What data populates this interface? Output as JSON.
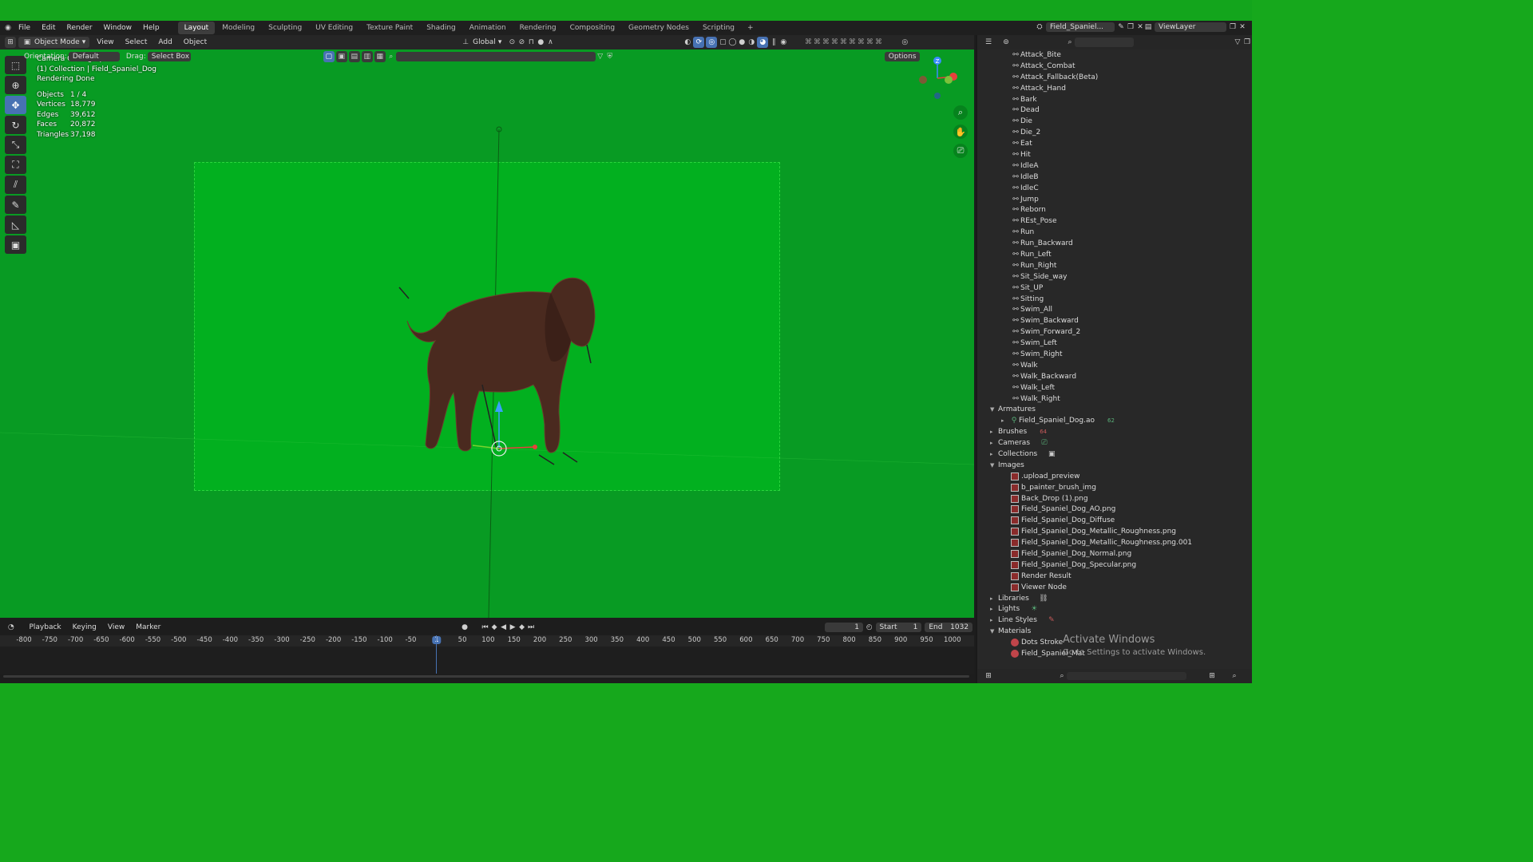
{
  "menu": [
    "File",
    "Edit",
    "Render",
    "Window",
    "Help"
  ],
  "workspaces": [
    "Layout",
    "Modeling",
    "Sculpting",
    "UV Editing",
    "Texture Paint",
    "Shading",
    "Animation",
    "Rendering",
    "Compositing",
    "Geometry Nodes",
    "Scripting"
  ],
  "workspace_add": "+",
  "scene_name": "Field_Spaniel...",
  "view_layer": "ViewLayer",
  "header": {
    "mode": "Object Mode",
    "items": [
      "View",
      "Select",
      "Add",
      "Object"
    ],
    "transform": "Global",
    "options": "Options"
  },
  "tool_settings": {
    "orientation_label": "Orientation:",
    "orientation_value": "Default",
    "drag_label": "Drag:",
    "drag_value": "Select Box"
  },
  "viewport_info": {
    "line1": "Camera Orthographic",
    "line2": "(1) Collection | Field_Spaniel_Dog",
    "line3": "Rendering Done",
    "stats": [
      {
        "k": "Objects",
        "v": "1 / 4"
      },
      {
        "k": "Vertices",
        "v": "18,779"
      },
      {
        "k": "Edges",
        "v": "39,612"
      },
      {
        "k": "Faces",
        "v": "20,872"
      },
      {
        "k": "Triangles",
        "v": "37,198"
      }
    ]
  },
  "outliner": {
    "actions": [
      "Attack_Bite",
      "Attack_Combat",
      "Attack_Fallback(Beta)",
      "Attack_Hand",
      "Bark",
      "Dead",
      "Die",
      "Die_2",
      "Eat",
      "Hit",
      "IdleA",
      "IdleB",
      "IdleC",
      "Jump",
      "Reborn",
      "REst_Pose",
      "Run",
      "Run_Backward",
      "Run_Left",
      "Run_Right",
      "Sit_Side_way",
      "Sit_UP",
      "Sitting",
      "Swim_All",
      "Swim_Backward",
      "Swim_Forward_2",
      "Swim_Left",
      "Swim_Right",
      "Walk",
      "Walk_Backward",
      "Walk_Left",
      "Walk_Right"
    ],
    "armatures_label": "Armatures",
    "armature_item": "Field_Spaniel_Dog.ao",
    "armature_count": "62",
    "brushes_label": "Brushes",
    "brushes_count": "64",
    "cameras_label": "Cameras",
    "collections_label": "Collections",
    "images_label": "Images",
    "images": [
      ".upload_preview",
      "b_painter_brush_img",
      "Back_Drop (1).png",
      "Field_Spaniel_Dog_AO.png",
      "Field_Spaniel_Dog_Diffuse",
      "Field_Spaniel_Dog_Metallic_Roughness.png",
      "Field_Spaniel_Dog_Metallic_Roughness.png.001",
      "Field_Spaniel_Dog_Normal.png",
      "Field_Spaniel_Dog_Specular.png",
      "Render Result",
      "Viewer Node"
    ],
    "libraries_label": "Libraries",
    "lights_label": "Lights",
    "linestyles_label": "Line Styles",
    "materials_label": "Materials",
    "materials": [
      "Dots Stroke",
      "Field_Spaniel_Mat"
    ]
  },
  "timeline": {
    "menus": [
      "Playback",
      "Keying",
      "View",
      "Marker"
    ],
    "current_frame": "1",
    "start_label": "Start",
    "start": "1",
    "end_label": "End",
    "end": "1032",
    "ruler": [
      "-800",
      "-750",
      "-700",
      "-650",
      "-600",
      "-550",
      "-500",
      "-450",
      "-400",
      "-350",
      "-300",
      "-250",
      "-200",
      "-150",
      "-100",
      "-50",
      "1",
      "50",
      "100",
      "150",
      "200",
      "250",
      "300",
      "350",
      "400",
      "450",
      "500",
      "550",
      "600",
      "650",
      "700",
      "750",
      "800",
      "850",
      "900",
      "950",
      "1000"
    ]
  },
  "watermark": {
    "title": "Activate Windows",
    "subtitle": "Go to Settings to activate Windows."
  },
  "colors": {
    "accent": "#4772b3",
    "viewport_bg": "#089b23",
    "camera_frame": "#02b01f"
  }
}
